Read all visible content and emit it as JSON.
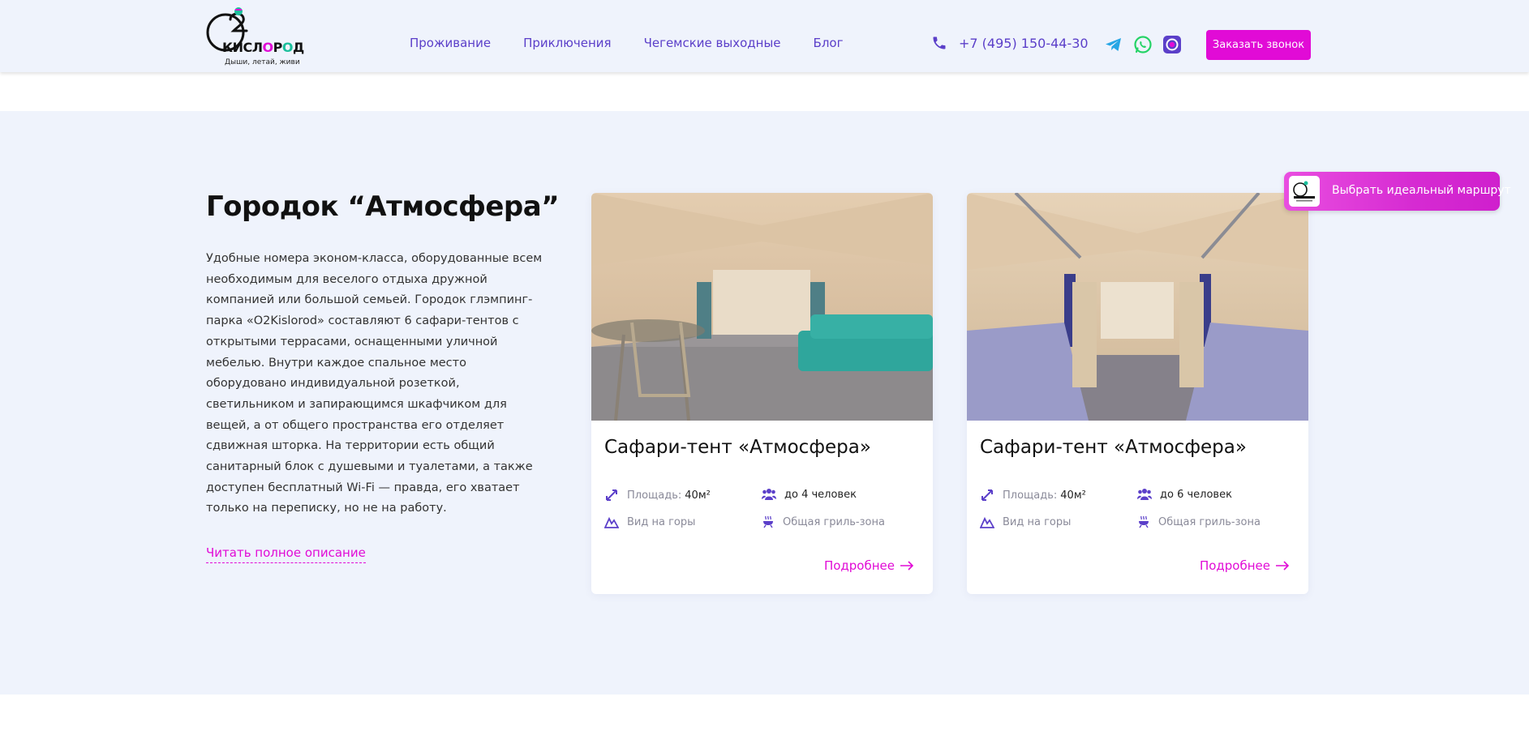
{
  "brand": {
    "name_part1": "КИСЛ",
    "name_o1": "О",
    "name_part2": "Р",
    "name_o2": "О",
    "name_part3": "Д",
    "tagline": "Дыши, летай, живи"
  },
  "nav": {
    "items": [
      {
        "label": "Проживание"
      },
      {
        "label": "Приключения"
      },
      {
        "label": "Чегемские выходные"
      },
      {
        "label": "Блог"
      }
    ]
  },
  "contacts": {
    "phone": "+7 (495) 150-44-30",
    "socials": [
      "telegram-icon",
      "whatsapp-icon",
      "viber-icon"
    ]
  },
  "header": {
    "cta_label": "Заказать звонок"
  },
  "section": {
    "title": "Городок “Атмосфера”",
    "description": "Удобные номера эконом-класса, оборудованные всем необходимым для веселого отдыха дружной компанией или большой семьей. Городок глэмпинг-парка «O2Kislorod» составляют 6 сафари-тентов с открытыми террасами, оснащенными уличной мебелью. Внутри каждое спальное место оборудовано индивидуальной розеткой, светильником и запирающимся шкафчиком для вещей, а от общего пространства его отделяет сдвижная шторка. На территории есть общий санитарный блок с душевыми и туалетами, а также доступен бесплатный Wi-Fi — правда, его хватает только на переписку, но не на работу.",
    "read_more": "Читать полное описание"
  },
  "cards": [
    {
      "title": "Сафари-тент «Атмосфера»",
      "area_label": "Площадь:",
      "area_value": "40м²",
      "guests": "до 4 человек",
      "view": "Вид на горы",
      "grill": "Общая гриль-зона",
      "more": "Подробнее"
    },
    {
      "title": "Сафари-тент «Атмосфера»",
      "area_label": "Площадь:",
      "area_value": "40м²",
      "guests": "до 6 человек",
      "view": "Вид на горы",
      "grill": "Общая гриль-зона",
      "more": "Подробнее"
    }
  ],
  "widget": {
    "label": "Выбрать идеальный маршрут"
  },
  "colors": {
    "accent": "#e10bd6",
    "nav": "#5b3fc9",
    "bg": "#eff3fc"
  }
}
